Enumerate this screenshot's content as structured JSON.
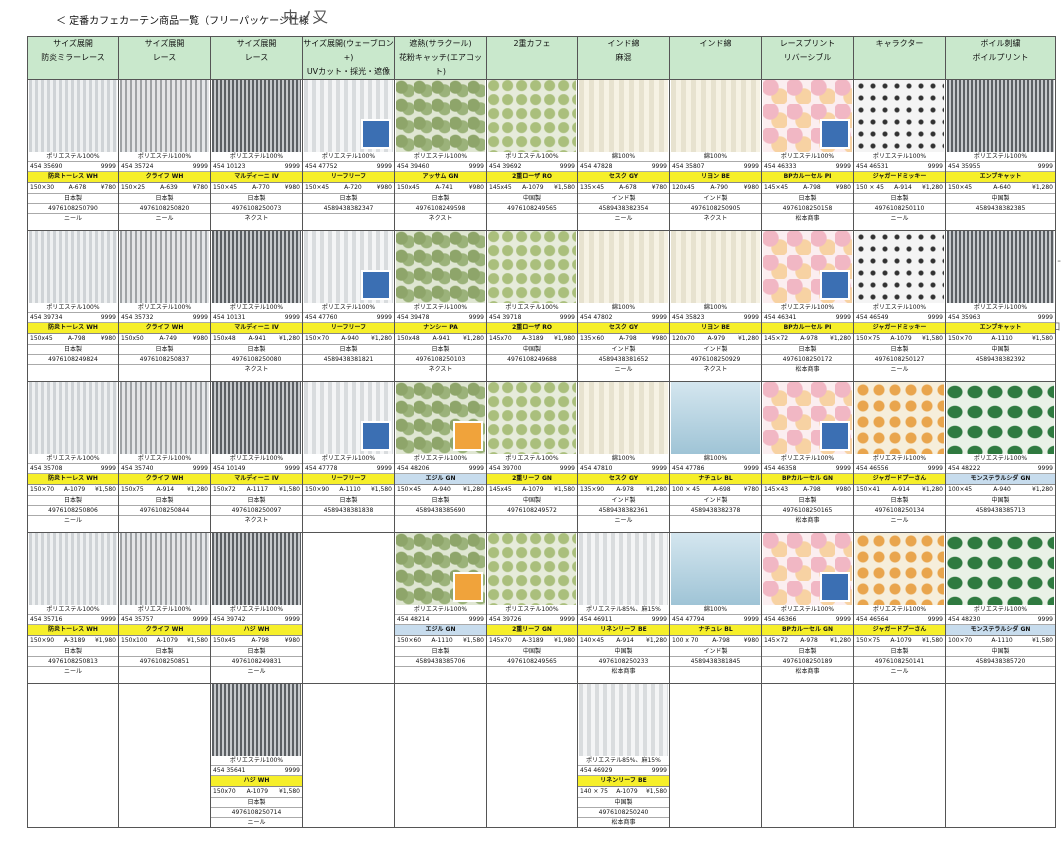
{
  "title": "＜ 定番カフェカーテン商品一覧（フリーパッケージ仕様 ＞",
  "handnote": "中ノ又",
  "margin_marks": [
    "/ -",
    "ロ"
  ],
  "headers": [
    {
      "l1": "サイズ展開",
      "l2": "防炎ミラーレース"
    },
    {
      "l1": "サイズ展開",
      "l2": "レース"
    },
    {
      "l1": "サイズ展開",
      "l2": "レース"
    },
    {
      "l1": "サイズ展開(ウェーブロン+)",
      "l2": "UVカット・採光・遮像"
    },
    {
      "l1": "遮熱(サラクール)",
      "l2": "花粉キャッチ(エアコット)"
    },
    {
      "l1": "2重カフェ",
      "l2": ""
    },
    {
      "l1": "インド綿",
      "l2": "麻混"
    },
    {
      "l1": "",
      "l2": "インド綿"
    },
    {
      "l1": "レースプリント",
      "l2": "リバーシブル"
    },
    {
      "l1": "キャラクター",
      "l2": ""
    },
    {
      "l1": "ボイル刺繍",
      "l2": "ボイルプリント"
    }
  ],
  "rows": [
    [
      {
        "photo": "lace",
        "mat": "ポリエステル100%",
        "code": "454 35690",
        "qty": "9999",
        "name": "防炎トーレス WH",
        "hl": "y",
        "size": "150×30",
        "model": "A-678",
        "price": "¥780",
        "origin": "日本製",
        "jan": "4976108250790",
        "maker": "ニール"
      },
      {
        "photo": "lace-b",
        "mat": "ポリエステル100%",
        "code": "454 35724",
        "qty": "9999",
        "name": "クライフ WH",
        "hl": "y",
        "size": "150×25",
        "model": "A-639",
        "price": "¥780",
        "origin": "日本製",
        "jan": "4976108250820",
        "maker": "ニール"
      },
      {
        "photo": "dark",
        "mat": "ポリエステル100%",
        "code": "454 10123",
        "qty": "9999",
        "name": "マルディーニ IV",
        "hl": "y",
        "size": "150×45",
        "model": "A-770",
        "price": "¥980",
        "origin": "日本製",
        "jan": "4976108250073",
        "maker": "ネクスト"
      },
      {
        "photo": "voile",
        "badge": "blue",
        "mat": "ポリエステル100%",
        "code": "454 47752",
        "qty": "9999",
        "name": "リーフリーフ",
        "hl": "y",
        "size": "150×45",
        "model": "A-720",
        "price": "¥980",
        "origin": "日本製",
        "jan": "4589438382347",
        "maker": ""
      },
      {
        "photo": "green",
        "mat": "ポリエステル100%",
        "code": "454 39460",
        "qty": "9999",
        "name": "アッサム GN",
        "hl": "y",
        "size": "150x45",
        "model": "A-741",
        "price": "¥980",
        "origin": "日本製",
        "jan": "4976108249598",
        "maker": "ネクスト"
      },
      {
        "photo": "leaf",
        "mat": "ポリエステル100%",
        "code": "454 39692",
        "qty": "9999",
        "name": "2重ローザ RO",
        "hl": "y",
        "size": "145x45",
        "model": "A-1079",
        "price": "¥1,580",
        "origin": "中国製",
        "jan": "4976108249565",
        "maker": ""
      },
      {
        "photo": "cotton",
        "mat": "綿100%",
        "code": "454 47828",
        "qty": "9999",
        "name": "セスク GY",
        "hl": "y",
        "size": "135×45",
        "model": "A-678",
        "price": "¥780",
        "origin": "インド製",
        "jan": "4589438382354",
        "maker": "ニール"
      },
      {
        "photo": "cotton",
        "mat": "綿100%",
        "code": "454 35807",
        "qty": "9999",
        "name": "リヨン BE",
        "hl": "y",
        "size": "120x45",
        "model": "A-790",
        "price": "¥980",
        "origin": "インド製",
        "jan": "4976108250905",
        "maker": "ネクスト"
      },
      {
        "photo": "pink",
        "badge": "blue",
        "mat": "ポリエステル100%",
        "code": "454 46333",
        "qty": "9999",
        "name": "BPカルーセル PI",
        "hl": "y",
        "size": "145×45",
        "model": "A-798",
        "price": "¥980",
        "origin": "日本製",
        "jan": "4976108250158",
        "maker": "松本商事"
      },
      {
        "photo": "char",
        "mat": "ポリエステル100%",
        "code": "454 46531",
        "qty": "9999",
        "name": "ジャガードミッキー",
        "hl": "y",
        "size": "150 × 45",
        "model": "A-914",
        "price": "¥1,280",
        "origin": "日本製",
        "jan": "4976108250110",
        "maker": "ニール"
      },
      {
        "photo": "dark",
        "mat": "ポリエステル100%",
        "code": "454 35955",
        "qty": "9999",
        "name": "エンブキャット",
        "hl": "y",
        "size": "150×45",
        "model": "A-640",
        "price": "¥1,280",
        "origin": "中国製",
        "jan": "4589438382385",
        "maker": ""
      }
    ],
    [
      {
        "photo": "lace",
        "mat": "ポリエステル100%",
        "code": "454 39734",
        "qty": "9999",
        "name": "防炎トーレス WH",
        "hl": "y",
        "size": "150x45",
        "model": "A-798",
        "price": "¥980",
        "origin": "日本製",
        "jan": "4976108249824",
        "maker": ""
      },
      {
        "photo": "lace-b",
        "mat": "ポリエステル100%",
        "code": "454 35732",
        "qty": "9999",
        "name": "クライフ WH",
        "hl": "y",
        "size": "150x50",
        "model": "A-749",
        "price": "¥980",
        "origin": "日本製",
        "jan": "4976108250837",
        "maker": ""
      },
      {
        "photo": "dark",
        "mat": "ポリエステル100%",
        "code": "454 10131",
        "qty": "9999",
        "name": "マルディーニ IV",
        "hl": "y",
        "size": "150x48",
        "model": "A-941",
        "price": "¥1,280",
        "origin": "日本製",
        "jan": "4976108250080",
        "maker": "ネクスト"
      },
      {
        "photo": "voile",
        "badge": "blue",
        "mat": "ポリエステル100%",
        "code": "454 47760",
        "qty": "9999",
        "name": "リーフリーフ",
        "hl": "y",
        "size": "150×70",
        "model": "A-940",
        "price": "¥1,280",
        "origin": "日本製",
        "jan": "4589438381821",
        "maker": ""
      },
      {
        "photo": "green",
        "mat": "ポリエステル100%",
        "code": "454 39478",
        "qty": "9999",
        "name": "ナンシー PA",
        "hl": "y",
        "size": "150x48",
        "model": "A-941",
        "price": "¥1,280",
        "origin": "日本製",
        "jan": "4976108250103",
        "maker": "ネクスト"
      },
      {
        "photo": "leaf",
        "mat": "ポリエステル100%",
        "code": "454 39718",
        "qty": "9999",
        "name": "2重ローザ RO",
        "hl": "y",
        "size": "145x70",
        "model": "A-3189",
        "price": "¥1,980",
        "origin": "中国製",
        "jan": "4976108249688",
        "maker": ""
      },
      {
        "photo": "cotton",
        "mat": "綿100%",
        "code": "454 47802",
        "qty": "9999",
        "name": "セスク GY",
        "hl": "y",
        "size": "135×60",
        "model": "A-798",
        "price": "¥980",
        "origin": "インド製",
        "jan": "4589438381652",
        "maker": "ニール"
      },
      {
        "photo": "cotton",
        "mat": "綿100%",
        "code": "454 35823",
        "qty": "9999",
        "name": "リヨン BE",
        "hl": "y",
        "size": "120x70",
        "model": "A-979",
        "price": "¥1,280",
        "origin": "インド製",
        "jan": "4976108250929",
        "maker": "ネクスト"
      },
      {
        "photo": "pink",
        "badge": "blue",
        "mat": "ポリエステル100%",
        "code": "454 46341",
        "qty": "9999",
        "name": "BPカルーセル PI",
        "hl": "y",
        "size": "145×72",
        "model": "A-978",
        "price": "¥1,280",
        "origin": "日本製",
        "jan": "4976108250172",
        "maker": "松本商事"
      },
      {
        "photo": "char",
        "mat": "ポリエステル100%",
        "code": "454 46549",
        "qty": "9999",
        "name": "ジャガードミッキー",
        "hl": "y",
        "size": "150×75",
        "model": "A-1079",
        "price": "¥1,580",
        "origin": "日本製",
        "jan": "4976108250127",
        "maker": "ニール"
      },
      {
        "photo": "dark",
        "mat": "ポリエステル100%",
        "code": "454 35963",
        "qty": "9999",
        "name": "エンブキャット",
        "hl": "y",
        "size": "150×70",
        "model": "A-1110",
        "price": "¥1,580",
        "origin": "中国製",
        "jan": "4589438382392",
        "maker": ""
      }
    ],
    [
      {
        "photo": "lace",
        "mat": "ポリエステル100%",
        "code": "454 35708",
        "qty": "9999",
        "name": "防炎トーレス WH",
        "hl": "y",
        "size": "150×70",
        "model": "A-1079",
        "price": "¥1,580",
        "origin": "日本製",
        "jan": "4976108250806",
        "maker": "ニール"
      },
      {
        "photo": "lace-b",
        "mat": "ポリエステル100%",
        "code": "454 35740",
        "qty": "9999",
        "name": "クライフ WH",
        "hl": "y",
        "size": "150x75",
        "model": "A-914",
        "price": "¥1,280",
        "origin": "日本製",
        "jan": "4976108250844",
        "maker": ""
      },
      {
        "photo": "dark",
        "mat": "ポリエステル100%",
        "code": "454 10149",
        "qty": "9999",
        "name": "マルディーニ IV",
        "hl": "y",
        "size": "150x72",
        "model": "A-1117",
        "price": "¥1,580",
        "origin": "日本製",
        "jan": "4976108250097",
        "maker": "ネクスト"
      },
      {
        "photo": "voile",
        "badge": "blue",
        "mat": "ポリエステル100%",
        "code": "454 47778",
        "qty": "9999",
        "name": "リーフリーフ",
        "hl": "y",
        "size": "150×90",
        "model": "A-1110",
        "price": "¥1,580",
        "origin": "日本製",
        "jan": "4589438381838",
        "maker": ""
      },
      {
        "photo": "green",
        "badge": "orange",
        "mat": "ポリエステル100%",
        "code": "454 48206",
        "qty": "9999",
        "name": "エジル GN",
        "hl": "b",
        "size": "150×45",
        "model": "A-940",
        "price": "¥1,280",
        "origin": "日本製",
        "jan": "4589438385690",
        "maker": ""
      },
      {
        "photo": "leaf",
        "mat": "ポリエステル100%",
        "code": "454 39700",
        "qty": "9999",
        "name": "2重リーフ GN",
        "hl": "y",
        "size": "145x45",
        "model": "A-1079",
        "price": "¥1,580",
        "origin": "中国製",
        "jan": "4976108249572",
        "maker": ""
      },
      {
        "photo": "cotton",
        "mat": "綿100%",
        "code": "454 47810",
        "qty": "9999",
        "name": "セスク GY",
        "hl": "y",
        "size": "135×90",
        "model": "A-978",
        "price": "¥1,280",
        "origin": "インド製",
        "jan": "4589438382361",
        "maker": "ニール"
      },
      {
        "photo": "blue",
        "mat": "綿100%",
        "code": "454 47786",
        "qty": "9999",
        "name": "ナチュレ BL",
        "hl": "y",
        "size": "100 × 45",
        "model": "A-698",
        "price": "¥780",
        "origin": "インド製",
        "jan": "4589438382378",
        "maker": ""
      },
      {
        "photo": "pink",
        "badge": "blue",
        "mat": "ポリエステル100%",
        "code": "454 46358",
        "qty": "9999",
        "name": "BPカルーセル GN",
        "hl": "y",
        "size": "145×43",
        "model": "A-798",
        "price": "¥980",
        "origin": "日本製",
        "jan": "4976108250165",
        "maker": "松本商事"
      },
      {
        "photo": "orange",
        "mat": "ポリエステル100%",
        "code": "454 46556",
        "qty": "9999",
        "name": "ジャガードプーさん",
        "hl": "y",
        "size": "150×41",
        "model": "A-914",
        "price": "¥1,280",
        "origin": "日本製",
        "jan": "4976108250134",
        "maker": "ニール"
      },
      {
        "photo": "tropic",
        "mat": "ポリエステル100%",
        "code": "454 48222",
        "qty": "9999",
        "name": "モンステラルシダ GN",
        "hl": "b",
        "size": "100×45",
        "model": "A-940",
        "price": "¥1,280",
        "origin": "中国製",
        "jan": "4589438385713",
        "maker": ""
      }
    ],
    [
      {
        "photo": "lace",
        "mat": "ポリエステル100%",
        "code": "454 35716",
        "qty": "9999",
        "name": "防炎トーレス WH",
        "hl": "y",
        "size": "150×90",
        "model": "A-3189",
        "price": "¥1,980",
        "origin": "日本製",
        "jan": "4976108250813",
        "maker": "ニール"
      },
      {
        "photo": "lace-b",
        "mat": "ポリエステル100%",
        "code": "454 35757",
        "qty": "9999",
        "name": "クライフ WH",
        "hl": "y",
        "size": "150x100",
        "model": "A-1079",
        "price": "¥1,580",
        "origin": "日本製",
        "jan": "4976108250851",
        "maker": ""
      },
      {
        "photo": "dark",
        "mat": "ポリエステル100%",
        "code": "454 39742",
        "qty": "9999",
        "name": "ハジ WH",
        "hl": "y",
        "size": "150x45",
        "model": "A-798",
        "price": "¥980",
        "origin": "日本製",
        "jan": "4976108249831",
        "maker": "ニール"
      },
      null,
      {
        "photo": "green",
        "badge": "orange",
        "mat": "ポリエステル100%",
        "code": "454 48214",
        "qty": "9999",
        "name": "エジル GN",
        "hl": "b",
        "size": "150×60",
        "model": "A-1110",
        "price": "¥1,580",
        "origin": "日本製",
        "jan": "4589438385706",
        "maker": ""
      },
      {
        "photo": "leaf",
        "mat": "ポリエステル100%",
        "code": "454 39726",
        "qty": "9999",
        "name": "2重リーフ GN",
        "hl": "y",
        "size": "145x70",
        "model": "A-3189",
        "price": "¥1,980",
        "origin": "中国製",
        "jan": "4976108249565",
        "maker": ""
      },
      {
        "photo": "voile",
        "mat": "ポリエステル85%、麻15%",
        "code": "454 46911",
        "qty": "9999",
        "name": "リネンリーフ BE",
        "hl": "y",
        "size": "140×45",
        "model": "A-914",
        "price": "¥1,280",
        "origin": "中国製",
        "jan": "4976108250233",
        "maker": "松本商事"
      },
      {
        "photo": "blue",
        "mat": "綿100%",
        "code": "454 47794",
        "qty": "9999",
        "name": "ナチュレ BL",
        "hl": "y",
        "size": "100 x 70",
        "model": "A-798",
        "price": "¥980",
        "origin": "インド製",
        "jan": "4589438381845",
        "maker": ""
      },
      {
        "photo": "pink",
        "badge": "blue",
        "mat": "ポリエステル100%",
        "code": "454 46366",
        "qty": "9999",
        "name": "BPカルーセル GN",
        "hl": "y",
        "size": "145×72",
        "model": "A-978",
        "price": "¥1,280",
        "origin": "日本製",
        "jan": "4976108250189",
        "maker": "松本商事"
      },
      {
        "photo": "orange",
        "mat": "ポリエステル100%",
        "code": "454 46564",
        "qty": "9999",
        "name": "ジャガードプーさん",
        "hl": "y",
        "size": "150×75",
        "model": "A-1079",
        "price": "¥1,580",
        "origin": "日本製",
        "jan": "4976108250141",
        "maker": "ニール"
      },
      {
        "photo": "tropic",
        "mat": "ポリエステル100%",
        "code": "454 48230",
        "qty": "9999",
        "name": "モンステラルシダ GN",
        "hl": "b",
        "size": "100×70",
        "model": "A-1110",
        "price": "¥1,580",
        "origin": "中国製",
        "jan": "4589438385720",
        "maker": ""
      }
    ],
    [
      null,
      null,
      {
        "photo": "dark",
        "mat": "ポリエステル100%",
        "code": "454 35641",
        "qty": "9999",
        "name": "ハジ WH",
        "hl": "y",
        "size": "150x70",
        "model": "A-1079",
        "price": "¥1,580",
        "origin": "日本製",
        "jan": "4976108250714",
        "maker": "ニール"
      },
      null,
      null,
      null,
      {
        "photo": "voile",
        "mat": "ポリエステル85%、麻15%",
        "code": "454 46929",
        "qty": "9999",
        "name": "リネンリーフ BE",
        "hl": "y",
        "size": "140 × 75",
        "model": "A-1079",
        "price": "¥1,580",
        "origin": "中国製",
        "jan": "4976108250240",
        "maker": "松本商事"
      },
      null,
      null,
      null,
      null
    ]
  ]
}
